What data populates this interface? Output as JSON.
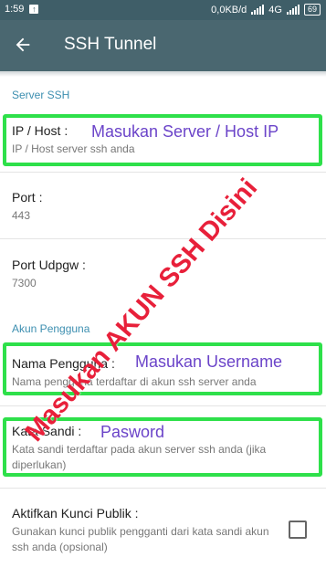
{
  "status": {
    "time": "1:59",
    "upload_icon": "upload-icon",
    "speed": "0,0KB/d",
    "network": "4G",
    "battery": "69"
  },
  "toolbar": {
    "title": "SSH Tunnel",
    "back_icon": "arrow-left-icon"
  },
  "sections": {
    "server": "Server SSH",
    "account": "Akun Pengguna"
  },
  "prefs": {
    "host": {
      "title": "IP / Host :",
      "summary": "IP / Host server ssh anda"
    },
    "port": {
      "title": "Port :",
      "summary": "443"
    },
    "udpgw": {
      "title": "Port Udpgw :",
      "summary": "7300"
    },
    "username": {
      "title": "Nama Pengguna :",
      "summary": "Nama pengguna terdaftar di akun ssh server anda"
    },
    "password": {
      "title": "Kata Sandi :",
      "summary": "Kata sandi terdaftar pada akun server ssh anda (jika diperlukan)"
    },
    "pubkey": {
      "title": "Aktifkan Kunci Publik :",
      "summary": "Gunakan kunci publik pengganti dari kata sandi akun ssh anda (opsional)",
      "checked": false
    }
  },
  "annotations": {
    "host": "Masukan Server / Host IP",
    "username": "Masukan Username",
    "password": "Pasword",
    "diagonal": "Masukan AKUN SSH Disini",
    "box_color": "#2ee04a",
    "text_color": "#6b44c9",
    "diag_color": "#e8203a"
  }
}
